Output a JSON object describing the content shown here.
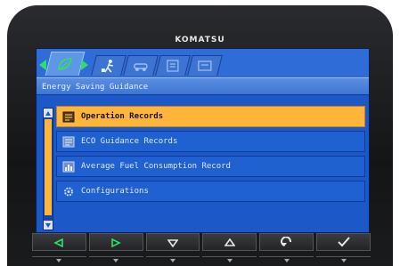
{
  "brand": "KOMATSU",
  "title": "Energy Saving Guidance",
  "tabs": [
    {
      "icon": "leaf-icon",
      "active": true
    },
    {
      "icon": "worker-icon",
      "active": false
    },
    {
      "icon": "machine-icon",
      "active": false
    },
    {
      "icon": "list-icon",
      "active": false
    },
    {
      "icon": "screen-icon",
      "active": false
    }
  ],
  "menu": [
    {
      "label": "Operation Records",
      "icon": "records-icon",
      "selected": true
    },
    {
      "label": "ECO Guidance Records",
      "icon": "eco-records-icon",
      "selected": false
    },
    {
      "label": "Average Fuel Consumption Record",
      "icon": "fuel-chart-icon",
      "selected": false
    },
    {
      "label": "Configurations",
      "icon": "settings-icon",
      "selected": false
    }
  ],
  "buttons": [
    {
      "icon": "left-arrow-icon"
    },
    {
      "icon": "right-arrow-icon"
    },
    {
      "icon": "down-arrow-icon"
    },
    {
      "icon": "up-arrow-icon"
    },
    {
      "icon": "return-icon"
    },
    {
      "icon": "check-icon"
    }
  ],
  "colors": {
    "screen": "#1c58c8",
    "highlight": "#ffb43a",
    "button_icon": "#2ee06a"
  }
}
